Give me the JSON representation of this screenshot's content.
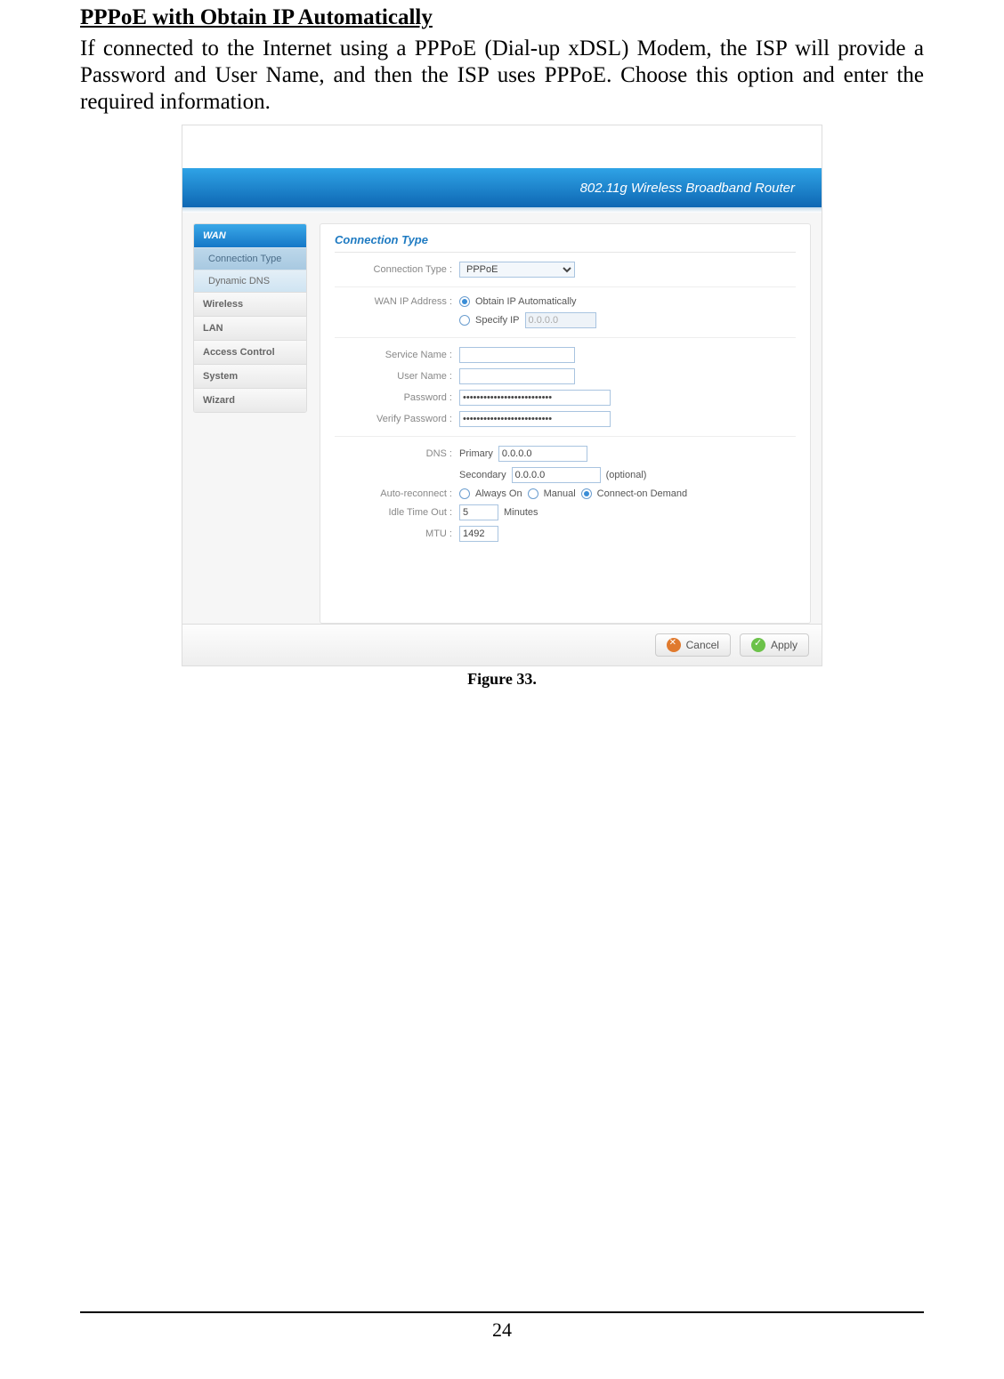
{
  "doc": {
    "section_title": "PPPoE with Obtain IP Automatically",
    "paragraph": "If connected to the Internet using a PPPoE (Dial-up xDSL) Modem, the ISP will provide a Password and User Name, and then the ISP uses PPPoE. Choose this option and enter the required information.",
    "figure_caption": "Figure 33.",
    "page_number": "24"
  },
  "router": {
    "banner_title": "802.11g Wireless Broadband Router",
    "sidebar": {
      "wan": "WAN",
      "sub_connection_type": "Connection Type",
      "sub_dynamic_dns": "Dynamic DNS",
      "wireless": "Wireless",
      "lan": "LAN",
      "access_control": "Access Control",
      "system": "System",
      "wizard": "Wizard"
    },
    "panel": {
      "title": "Connection Type",
      "labels": {
        "connection_type": "Connection Type :",
        "wan_ip": "WAN IP Address :",
        "service_name": "Service Name :",
        "user_name": "User Name :",
        "password": "Password :",
        "verify_password": "Verify Password :",
        "dns": "DNS :",
        "auto_reconnect": "Auto-reconnect :",
        "idle_timeout": "Idle Time Out :",
        "mtu": "MTU :"
      },
      "values": {
        "connection_type_select": "PPPoE",
        "obtain_ip": "Obtain IP Automatically",
        "specify_ip": "Specify IP",
        "specify_ip_value": "0.0.0.0",
        "password_dots": "••••••••••••••••••••••••••",
        "verify_password_dots": "••••••••••••••••••••••••••",
        "dns_primary_label": "Primary",
        "dns_primary_value": "0.0.0.0",
        "dns_secondary_label": "Secondary",
        "dns_secondary_value": "0.0.0.0",
        "dns_optional": "(optional)",
        "always_on": "Always On",
        "manual": "Manual",
        "connect_on_demand": "Connect-on Demand",
        "idle_value": "5",
        "idle_unit": "Minutes",
        "mtu_value": "1492"
      }
    },
    "buttons": {
      "cancel": "Cancel",
      "apply": "Apply"
    }
  }
}
